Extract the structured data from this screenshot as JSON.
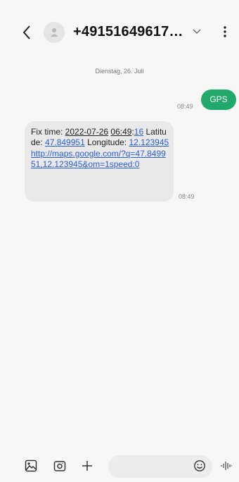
{
  "header": {
    "back_icon": "chevron-left-icon",
    "avatar_icon": "person-icon",
    "contact": "+49151649617…",
    "expand_icon": "chevron-down-icon",
    "more_icon": "more-vertical-icon"
  },
  "conversation": {
    "date_separator": "Dienstag, 26. Juli",
    "outgoing": {
      "text": "GPS",
      "time": "08:49",
      "bubble_color": "#22a86a"
    },
    "incoming": {
      "t1": "Fix time: ",
      "fix_date": "2022-07-26",
      "t2": " ",
      "fix_time_hm": "06:49",
      "t3": ":",
      "fix_time_s": "16",
      "t4": " Latitude: ",
      "latitude": "47.849951",
      "t5": " Longitude: ",
      "longitude": "12.123945",
      "t6": " ",
      "url": "http://maps.google.com/?q=47.849951,12.123945&om=1speed:0",
      "time": "08:49",
      "link_color": "#2b5fd0"
    }
  },
  "composer": {
    "gallery_icon": "image-icon",
    "camera_icon": "camera-icon",
    "add_icon": "plus-icon",
    "emoji_icon": "smiley-icon",
    "voice_icon": "waveform-icon"
  }
}
